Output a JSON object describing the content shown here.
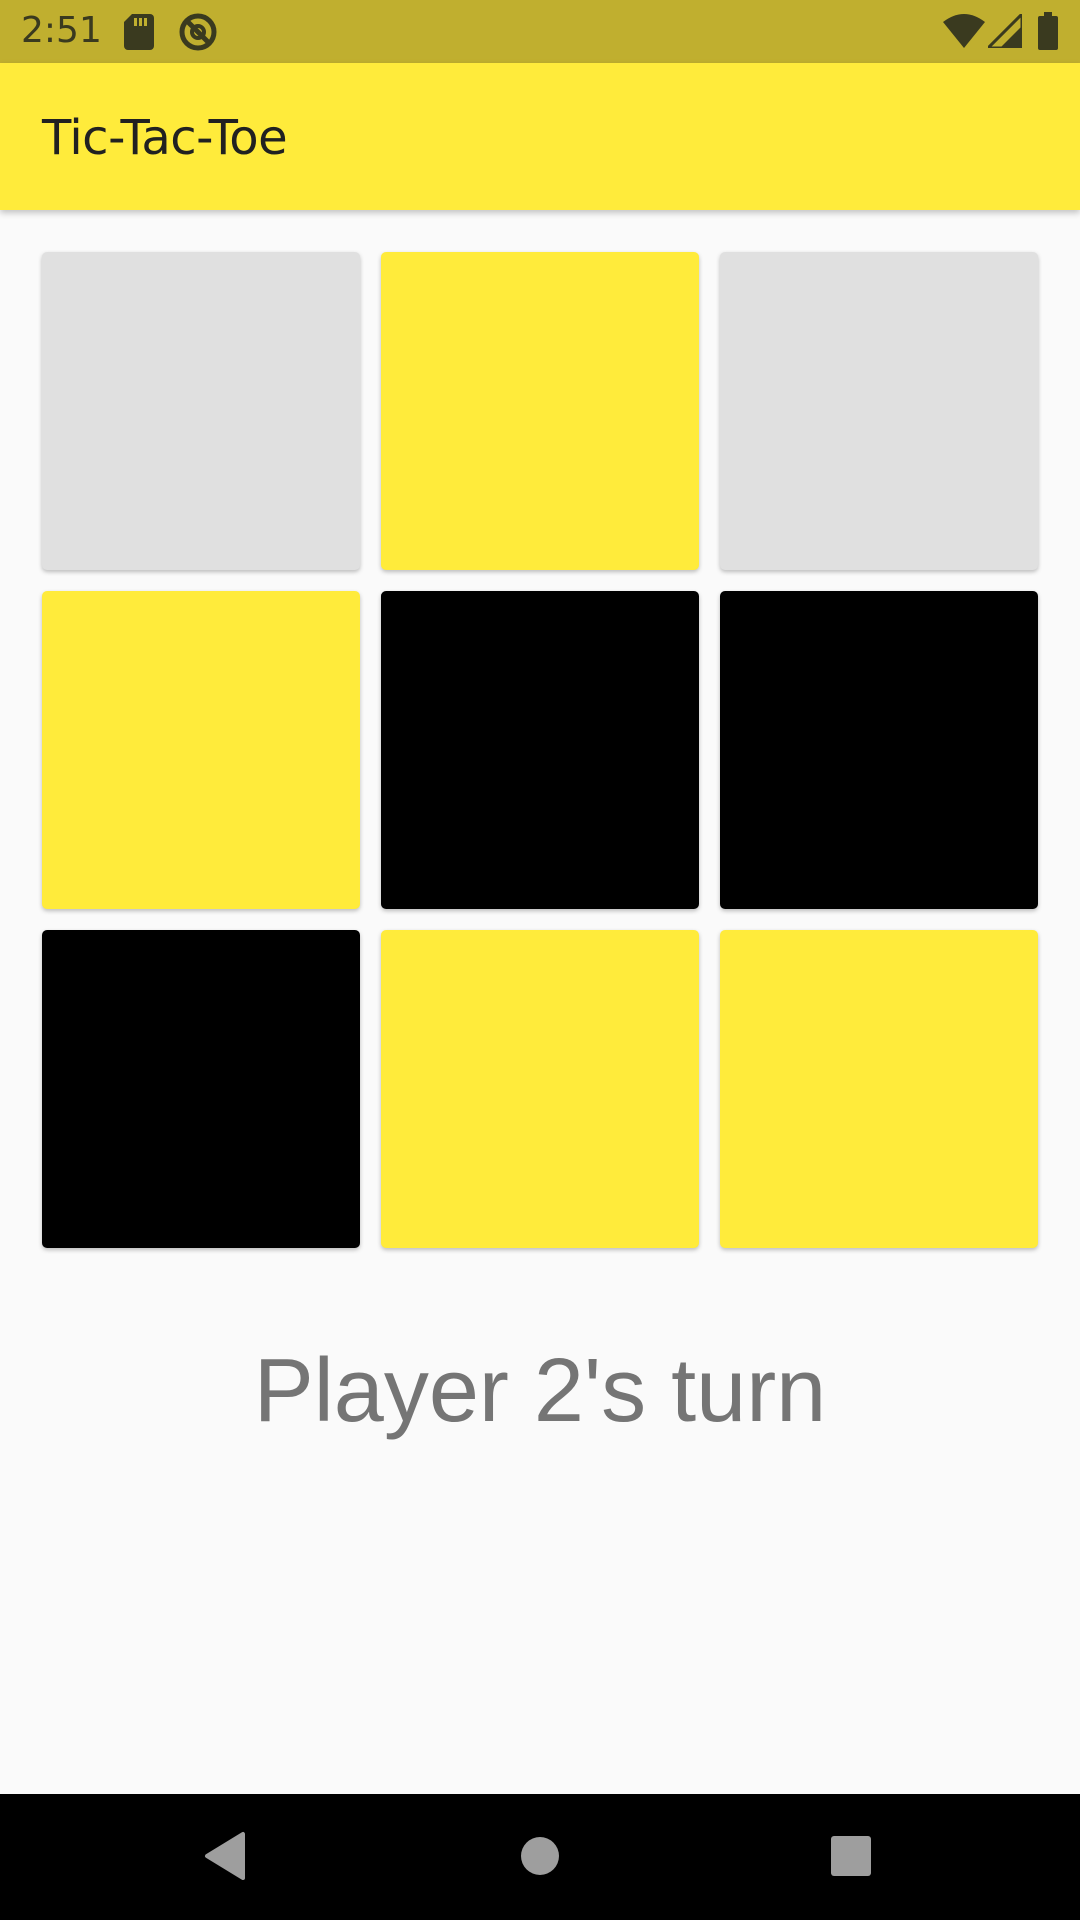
{
  "status_bar": {
    "time": "2:51",
    "icons": [
      "sd-card-icon",
      "sync-blocked-icon",
      "wifi-icon",
      "signal-icon",
      "battery-icon"
    ]
  },
  "app_bar": {
    "title": "Tic-Tac-Toe",
    "color": "#ffeb3b"
  },
  "board": {
    "rows": 3,
    "cols": 3,
    "cells": [
      {
        "state": "empty"
      },
      {
        "state": "player1"
      },
      {
        "state": "empty"
      },
      {
        "state": "player1"
      },
      {
        "state": "player2"
      },
      {
        "state": "player2"
      },
      {
        "state": "player2"
      },
      {
        "state": "player1"
      },
      {
        "state": "player1"
      }
    ],
    "colors": {
      "empty": "#e0e0e0",
      "player1": "#ffeb3b",
      "player2": "#000000"
    }
  },
  "turn": {
    "text": "Player 2's turn"
  },
  "nav_bar": {
    "buttons": [
      "back-icon",
      "home-icon",
      "recents-icon"
    ]
  }
}
